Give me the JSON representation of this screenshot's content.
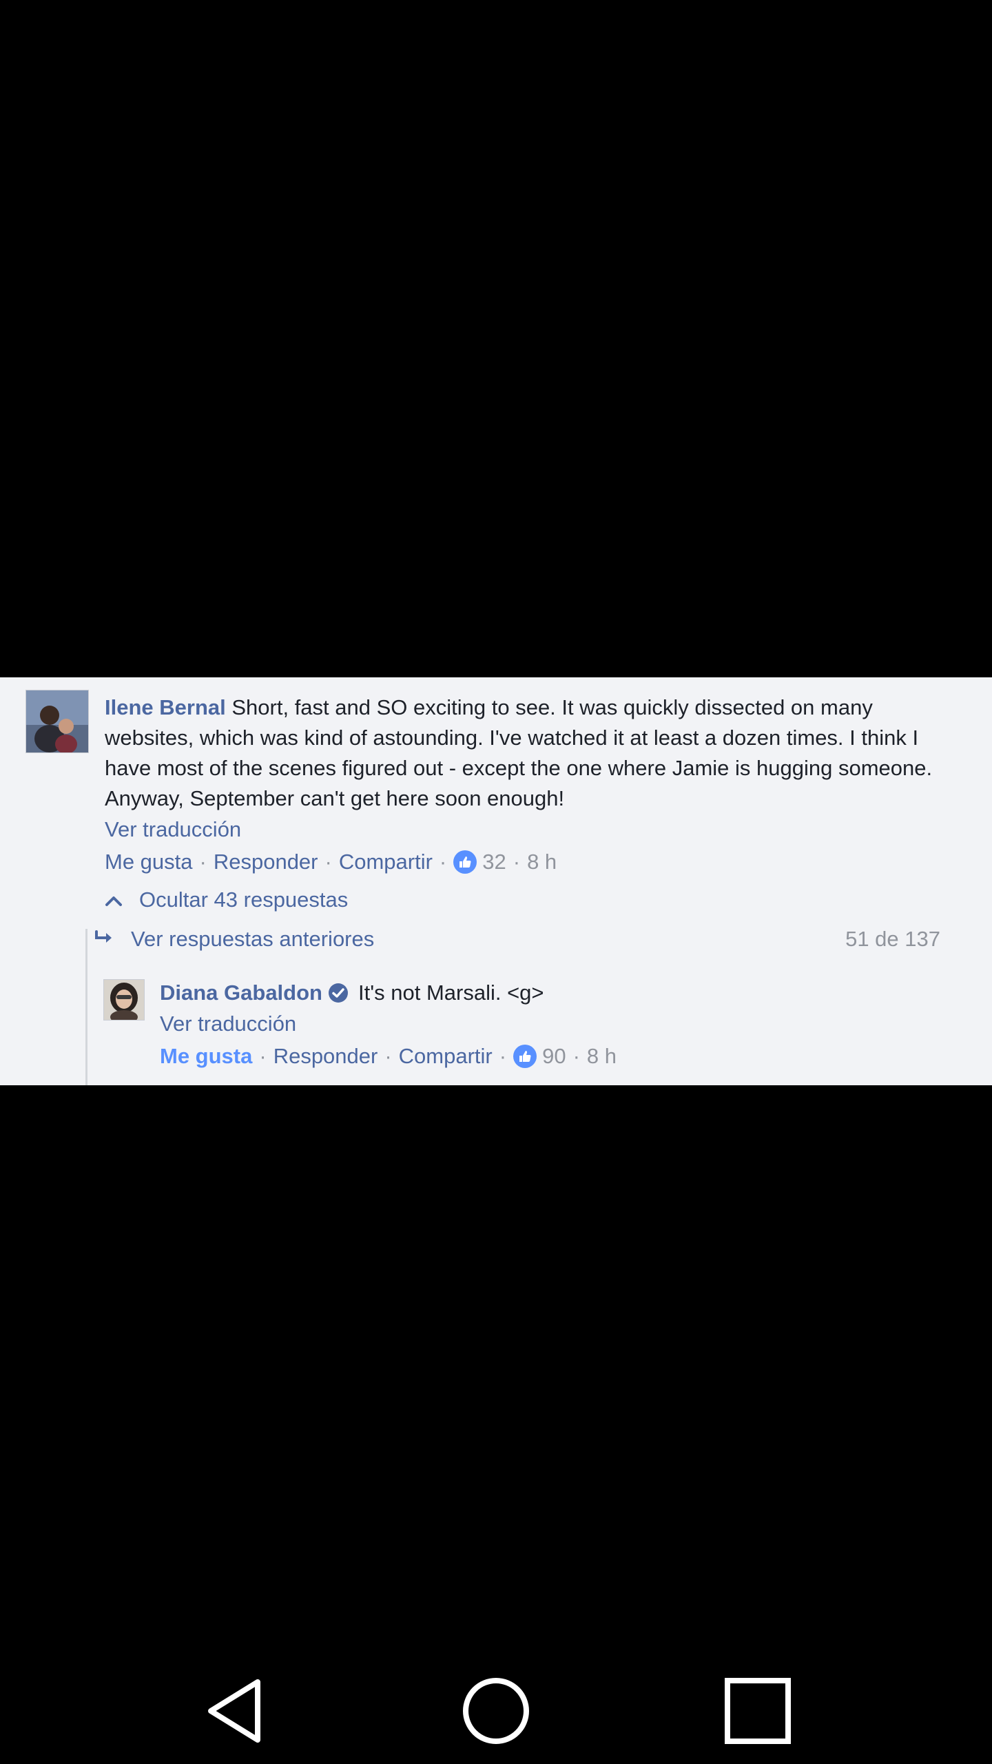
{
  "comment": {
    "author": "Ilene Bernal",
    "text": "Short, fast and SO exciting to see. It was quickly dissected on many websites, which was kind of astounding. I've watched it at least a dozen times. I think I have most of the scenes figured out - except the one where Jamie is hugging someone. Anyway, September can't get here soon enough!",
    "translate_label": "Ver traducción",
    "actions": {
      "like": "Me gusta",
      "reply": "Responder",
      "share": "Compartir",
      "likes_count": "32",
      "time": "8 h",
      "separator": "·"
    }
  },
  "replies": {
    "hide_label": "Ocultar 43 respuestas",
    "previous_label": "Ver respuestas anteriores",
    "counter": "51 de 137"
  },
  "reply": {
    "author": "Diana Gabaldon",
    "text": "It's not Marsali. <g>",
    "translate_label": "Ver traducción",
    "actions": {
      "like": "Me gusta",
      "reply": "Responder",
      "share": "Compartir",
      "likes_count": "90",
      "time": "8 h",
      "separator": "·"
    }
  },
  "colors": {
    "link": "#4b67a1",
    "like_badge": "#5890ff",
    "meta": "#90949c",
    "background": "#f2f3f6"
  },
  "icons": {
    "like_badge": "thumbs-up-icon",
    "verified": "verified-badge-icon",
    "collapse": "chevron-up-icon",
    "previous": "reply-arrow-icon",
    "nav_back": "back-triangle-icon",
    "nav_home": "home-circle-icon",
    "nav_recents": "recents-square-icon"
  }
}
